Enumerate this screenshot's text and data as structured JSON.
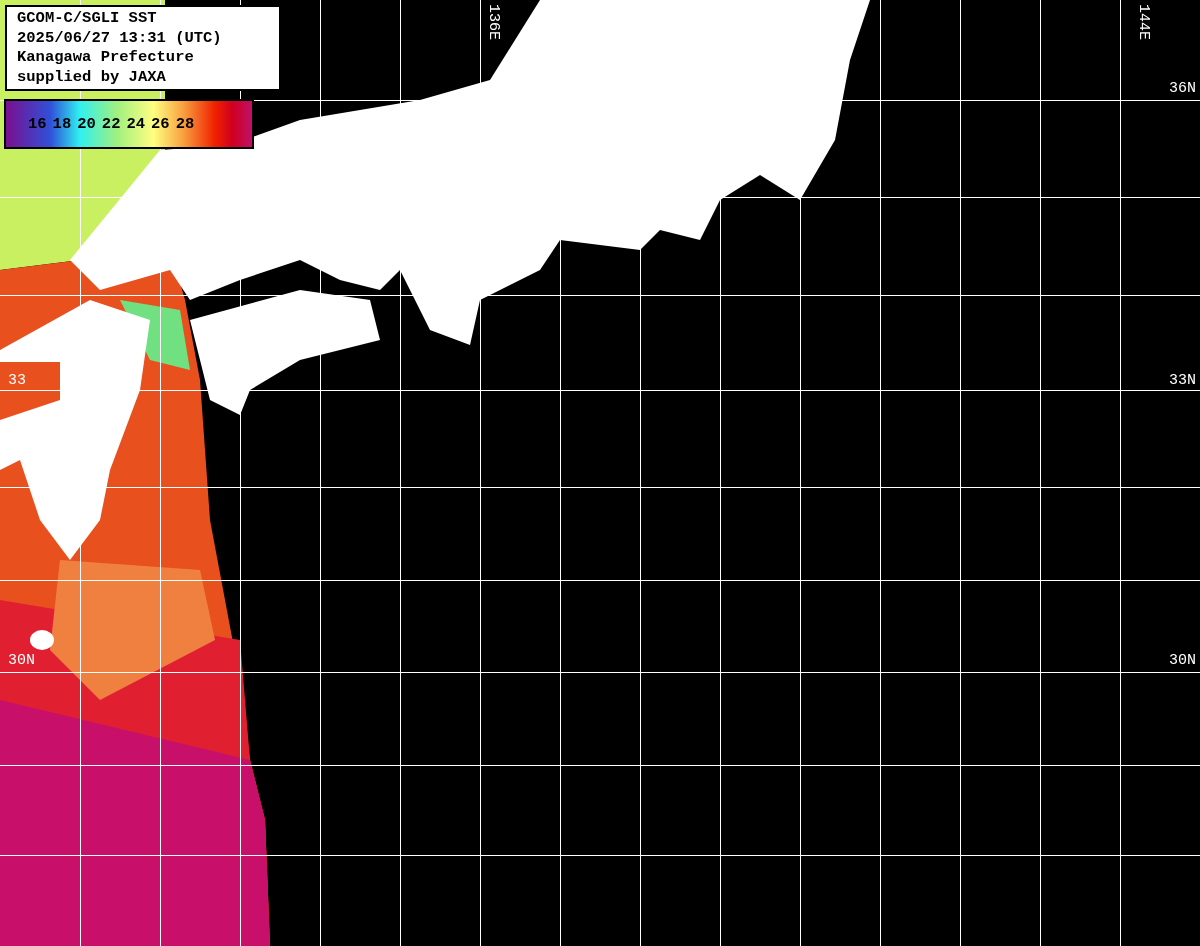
{
  "info_box": {
    "lines": [
      "GCOM-C/SGLI SST",
      "2025/06/27 13:31 (UTC)",
      "Kanagawa Prefecture",
      "supplied by JAXA"
    ]
  },
  "legend": {
    "ticks": [
      "16",
      "18",
      "20",
      "22",
      "24",
      "26",
      "28"
    ]
  },
  "longitude_labels": [
    "136E",
    "144E"
  ],
  "latitude_labels": [
    {
      "text": "36N",
      "kind": "right"
    },
    {
      "text": "33",
      "kind": "left"
    },
    {
      "text": "33N",
      "kind": "right"
    },
    {
      "text": "30N",
      "kind": "left"
    },
    {
      "text": "30N",
      "kind": "right"
    }
  ]
}
